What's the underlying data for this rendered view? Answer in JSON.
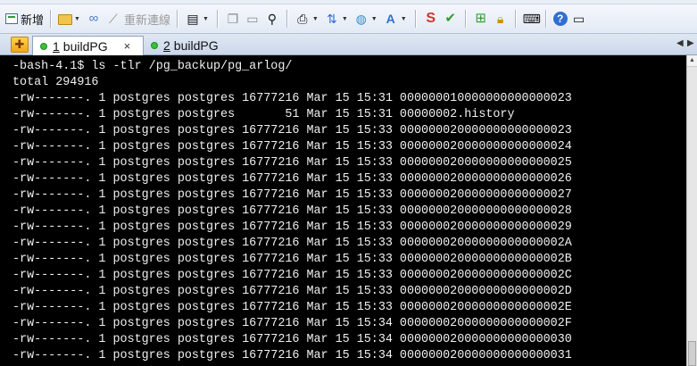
{
  "toolbar": {
    "new_label": "新增",
    "reconnect_label": "重新連線"
  },
  "tabs": [
    {
      "number": "1",
      "label": "buildPG",
      "active": true,
      "close": "×"
    },
    {
      "number": "2",
      "label": "buildPG",
      "active": false
    }
  ],
  "terminal": {
    "lines": [
      "-bash-4.1$ ls -tlr /pg_backup/pg_arlog/",
      "total 294916",
      "-rw-------. 1 postgres postgres 16777216 Mar 15 15:31 000000010000000000000023",
      "-rw-------. 1 postgres postgres       51 Mar 15 15:31 00000002.history",
      "-rw-------. 1 postgres postgres 16777216 Mar 15 15:33 000000020000000000000023",
      "-rw-------. 1 postgres postgres 16777216 Mar 15 15:33 000000020000000000000024",
      "-rw-------. 1 postgres postgres 16777216 Mar 15 15:33 000000020000000000000025",
      "-rw-------. 1 postgres postgres 16777216 Mar 15 15:33 000000020000000000000026",
      "-rw-------. 1 postgres postgres 16777216 Mar 15 15:33 000000020000000000000027",
      "-rw-------. 1 postgres postgres 16777216 Mar 15 15:33 000000020000000000000028",
      "-rw-------. 1 postgres postgres 16777216 Mar 15 15:33 000000020000000000000029",
      "-rw-------. 1 postgres postgres 16777216 Mar 15 15:33 00000002000000000000002A",
      "-rw-------. 1 postgres postgres 16777216 Mar 15 15:33 00000002000000000000002B",
      "-rw-------. 1 postgres postgres 16777216 Mar 15 15:33 00000002000000000000002C",
      "-rw-------. 1 postgres postgres 16777216 Mar 15 15:33 00000002000000000000002D",
      "-rw-------. 1 postgres postgres 16777216 Mar 15 15:33 00000002000000000000002E",
      "-rw-------. 1 postgres postgres 16777216 Mar 15 15:34 00000002000000000000002F",
      "-rw-------. 1 postgres postgres 16777216 Mar 15 15:34 000000020000000000000030",
      "-rw-------. 1 postgres postgres 16777216 Mar 15 15:34 000000020000000000000031"
    ]
  }
}
